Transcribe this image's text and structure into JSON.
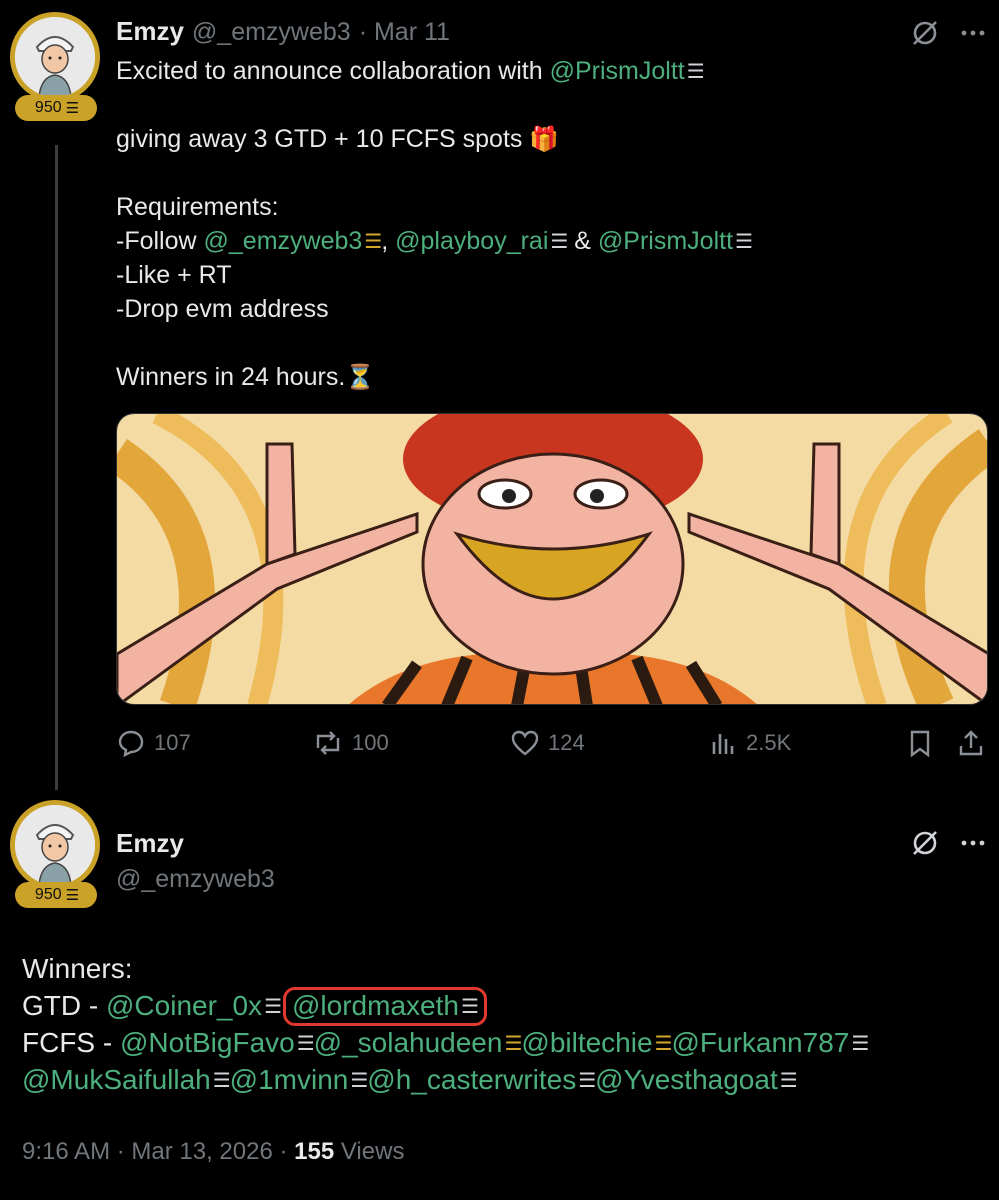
{
  "tweet1": {
    "name": "Emzy",
    "handle": "@_emzyweb3",
    "date": "· Mar 11",
    "badge": "950",
    "line1_text": "Excited to announce collaboration with ",
    "line1_mention": "@PrismJoltt",
    "line2_text": "giving away 3 GTD + 10 FCFS spots",
    "line2_emoji": "🎁",
    "req_title": "Requirements:",
    "follow_prefix": "-Follow ",
    "follow_m1": "@_emzyweb3",
    "follow_sep1": ", ",
    "follow_m2": "@playboy_rai",
    "follow_sep2": " & ",
    "follow_m3": "@PrismJoltt",
    "req2": "-Like + RT",
    "req3": "-Drop evm address",
    "winners_text": "Winners in 24 hours.",
    "winners_emoji": "⏳",
    "stats": {
      "replies": "107",
      "retweets": "100",
      "likes": "124",
      "views": "2.5K"
    }
  },
  "tweet2": {
    "name": "Emzy",
    "handle": "@_emzyweb3",
    "badge": "950",
    "winners_label": "Winners:",
    "gtd_label": "GTD - ",
    "gtd_m1": "@Coiner_0x",
    "gtd_m2": "@lordmaxeth",
    "fcfs_label": "FCFS - ",
    "fcfs_m1": "@NotBigFavo",
    "fcfs_m2": "@_solahudeen",
    "fcfs_m3": "@biltechie",
    "fcfs_m4": "@Furkann787",
    "fcfs_m5": "@MukSaifullah",
    "fcfs_m6": "@1mvinn",
    "fcfs_m7": "@h_casterwrites",
    "fcfs_m8": "@Yvesthagoat",
    "time": "9:16 AM · Mar 13, 2026 · ",
    "views_count": "155",
    "views_label": " Views"
  },
  "colors": {
    "background": "#000000",
    "mention": "#4caf7d",
    "gold": "#c9a227",
    "muted": "#71767b",
    "highlight": "#e0392f"
  }
}
